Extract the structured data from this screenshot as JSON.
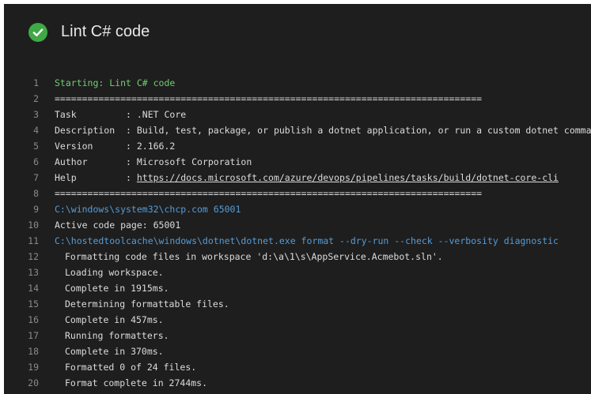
{
  "header": {
    "title": "Lint C# code",
    "status": "succeeded",
    "status_color": "#3fa946"
  },
  "log": {
    "lines": [
      {
        "num": "1",
        "text": "Starting: Lint C# code",
        "style": "green"
      },
      {
        "num": "2",
        "text": "==============================================================================",
        "style": "normal"
      },
      {
        "num": "3",
        "text": "Task         : .NET Core",
        "style": "normal"
      },
      {
        "num": "4",
        "text": "Description  : Build, test, package, or publish a dotnet application, or run a custom dotnet command",
        "style": "normal"
      },
      {
        "num": "5",
        "text": "Version      : 2.166.2",
        "style": "normal"
      },
      {
        "num": "6",
        "text": "Author       : Microsoft Corporation",
        "style": "normal"
      },
      {
        "num": "7",
        "prefix": "Help         : ",
        "link": "https://docs.microsoft.com/azure/devops/pipelines/tasks/build/dotnet-core-cli",
        "style": "link"
      },
      {
        "num": "8",
        "text": "==============================================================================",
        "style": "normal"
      },
      {
        "num": "9",
        "text": "C:\\windows\\system32\\chcp.com 65001",
        "style": "blue"
      },
      {
        "num": "10",
        "text": "Active code page: 65001",
        "style": "normal"
      },
      {
        "num": "11",
        "text": "C:\\hostedtoolcache\\windows\\dotnet\\dotnet.exe format --dry-run --check --verbosity diagnostic",
        "style": "blue"
      },
      {
        "num": "12",
        "text": "Formatting code files in workspace 'd:\\a\\1\\s\\AppService.Acmebot.sln'.",
        "style": "indent"
      },
      {
        "num": "13",
        "text": "Loading workspace.",
        "style": "indent"
      },
      {
        "num": "14",
        "text": "Complete in 1915ms.",
        "style": "indent"
      },
      {
        "num": "15",
        "text": "Determining formattable files.",
        "style": "indent"
      },
      {
        "num": "16",
        "text": "Complete in 457ms.",
        "style": "indent"
      },
      {
        "num": "17",
        "text": "Running formatters.",
        "style": "indent"
      },
      {
        "num": "18",
        "text": "Complete in 370ms.",
        "style": "indent"
      },
      {
        "num": "19",
        "text": "Formatted 0 of 24 files.",
        "style": "indent"
      },
      {
        "num": "20",
        "text": "Format complete in 2744ms.",
        "style": "indent"
      }
    ]
  }
}
